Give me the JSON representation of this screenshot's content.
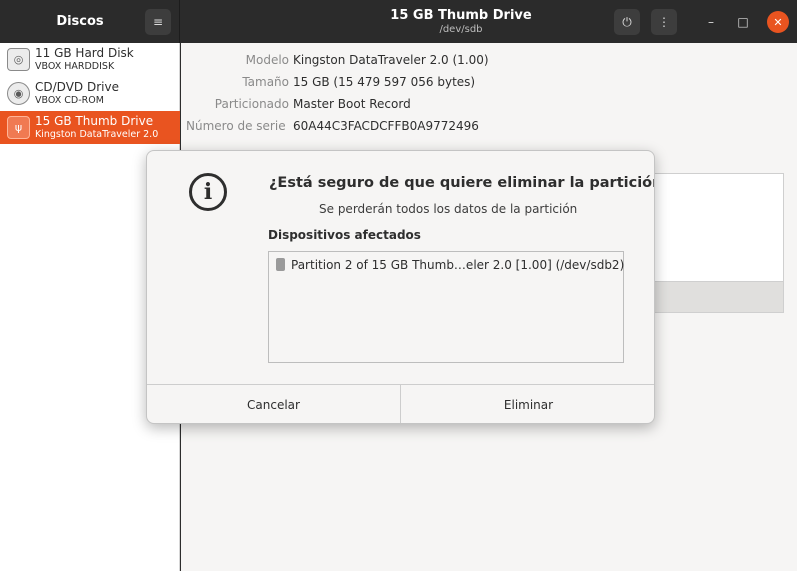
{
  "header": {
    "left_title": "Discos",
    "title": "15 GB Thumb Drive",
    "subtitle": "/dev/sdb",
    "icons": {
      "menu": "hamburger-icon",
      "power": "power-icon",
      "more": "vertical-dots-icon",
      "minimize": "minimize-icon",
      "maximize": "maximize-icon",
      "close": "close-icon"
    },
    "accent": "#e95420"
  },
  "sidebar": {
    "items": [
      {
        "name": "11 GB Hard Disk",
        "sub": "VBOX HARDDISK",
        "icon": "hard-disk-icon"
      },
      {
        "name": "CD/DVD Drive",
        "sub": "VBOX CD-ROM",
        "icon": "cd-icon"
      },
      {
        "name": "15 GB Thumb Drive",
        "sub": "Kingston DataTraveler 2.0",
        "icon": "usb-icon",
        "selected": true
      }
    ]
  },
  "drive_info": {
    "model_label": "Modelo",
    "model": "Kingston DataTraveler 2.0 (1.00)",
    "size_label": "Tamaño",
    "size": "15 GB (15 479 597 056 bytes)",
    "partitioning_label": "Particionado",
    "partitioning": "Master Boot Record",
    "serial_label": "Número de serie",
    "serial": "60A44C3FACDCFFB0A9772496"
  },
  "dialog": {
    "title": "¿Está seguro de que quiere eliminar la partición?",
    "message": "Se perderán todos los datos de la partición",
    "affected_label": "Dispositivos afectados",
    "affected_items": [
      "Partition 2 of 15 GB Thumb…eler 2.0 [1.00] (/dev/sdb2)"
    ],
    "cancel_label": "Cancelar",
    "delete_label": "Eliminar"
  }
}
